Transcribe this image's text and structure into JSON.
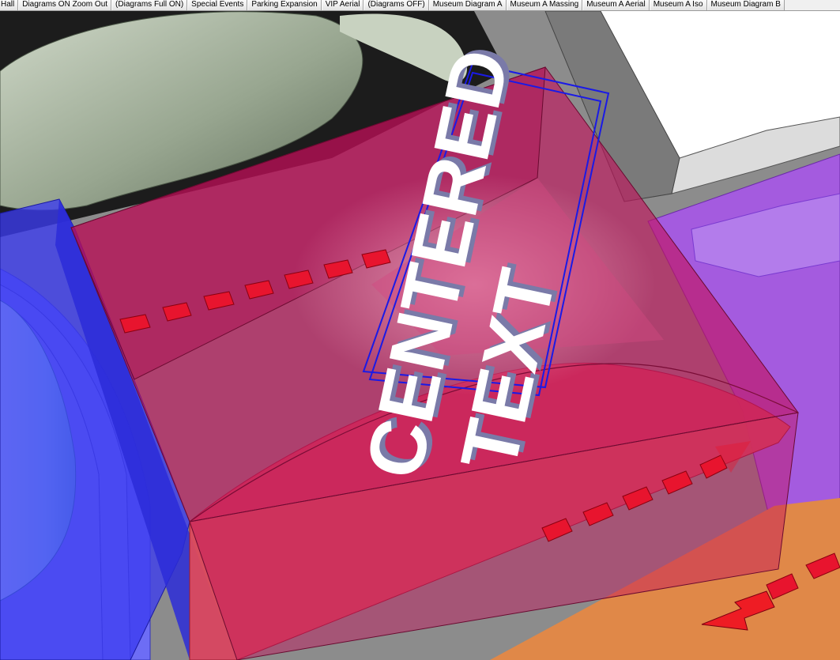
{
  "tabs": [
    {
      "label": "Hall"
    },
    {
      "label": "Diagrams ON Zoom Out"
    },
    {
      "label": "(Diagrams Full ON)"
    },
    {
      "label": "Special Events"
    },
    {
      "label": "Parking Expansion"
    },
    {
      "label": "VIP Aerial"
    },
    {
      "label": "(Diagrams OFF)"
    },
    {
      "label": "Museum Diagram A"
    },
    {
      "label": "Museum A Massing"
    },
    {
      "label": "Museum A Aerial"
    },
    {
      "label": "Museum A Iso"
    },
    {
      "label": "Museum Diagram B"
    }
  ],
  "model": {
    "text_line_1": "CENTERED",
    "text_line_2": "TEXT",
    "colors": {
      "magenta_volume": "#c4125c",
      "red_zone": "#dc4a5c",
      "blue_volume": "#3b3bf0",
      "purple_volume": "#a655e8",
      "orange_zone": "#e08848",
      "cyan_cylinder": "#a8f5f8",
      "green_mass": "#a8b4a0",
      "white_building": "#f4f4f4",
      "selection_blue": "#1a1ae6",
      "arrow_red": "#ee1c24",
      "text_white": "#ffffff"
    }
  }
}
